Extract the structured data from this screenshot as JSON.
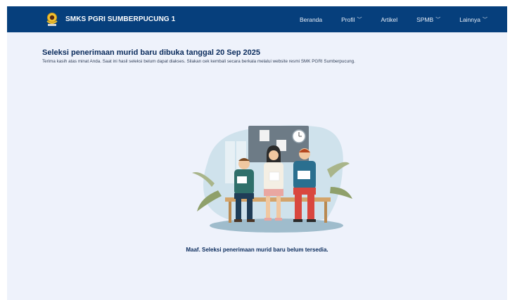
{
  "header": {
    "brand": "SMKS PGRI SUMBERPUCUNG 1",
    "nav": [
      {
        "label": "Beranda",
        "dropdown": false
      },
      {
        "label": "Profil",
        "dropdown": true
      },
      {
        "label": "Artikel",
        "dropdown": false
      },
      {
        "label": "SPMB",
        "dropdown": true
      },
      {
        "label": "Lainnya",
        "dropdown": true
      }
    ]
  },
  "main": {
    "title": "Seleksi penerimaan murid baru dibuka tanggal 20 Sep 2025",
    "subtitle": "Terima kasih atas minat Anda. Saat ini hasil seleksi belum dapat diakses. Silakan cek kembali secara berkala melalui website resmi SMK PGRI Sumberpucung.",
    "message": "Maaf. Seleksi penerimaan murid baru belum tersedia."
  },
  "colors": {
    "navbar": "#063f7c",
    "background": "#eef2fb",
    "heading": "#0a2b5c"
  }
}
